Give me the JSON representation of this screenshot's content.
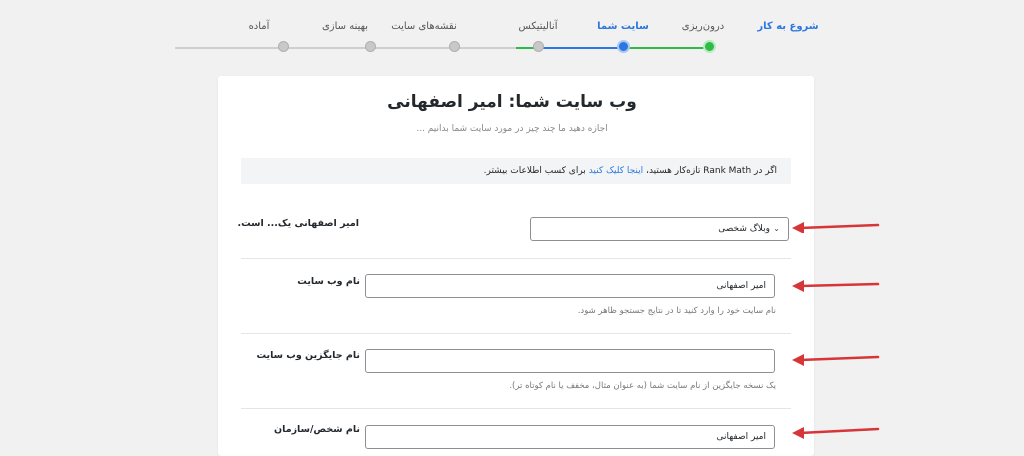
{
  "steps": [
    {
      "label": "شروع به کار",
      "state": "start"
    },
    {
      "label": "درون‌ریزی",
      "state": "done"
    },
    {
      "label": "سایت شما",
      "state": "active"
    },
    {
      "label": "آنالیتیکس",
      "state": "pending"
    },
    {
      "label": "نقشه‌های سایت",
      "state": "pending"
    },
    {
      "label": "بهینه سازی",
      "state": "pending"
    },
    {
      "label": "آماده",
      "state": "pending"
    }
  ],
  "colors": {
    "accent": "#2c76e0",
    "done": "#2fbb45",
    "arrow": "#d63638"
  },
  "header": {
    "title": "وب سایت شما: امیر اصفهانی",
    "subtitle": "اجازه دهید ما چند چیز در مورد سایت شما بدانیم ..."
  },
  "notice": {
    "prefix": "اگر در Rank Math تازه‌کار هستید،",
    "link": "اینجا کلیک کنید",
    "suffix": "برای کسب اطلاعات بیشتر."
  },
  "fields": {
    "site_type": {
      "label": "امیر اصفهانی یک... است.",
      "value": "وبلاگ شخصی"
    },
    "site_name": {
      "label": "نام وب سایت",
      "value": "امیر اصفهانی",
      "hint": "نام سایت خود را وارد کنید تا در نتایج جستجو ظاهر شود."
    },
    "alt_name": {
      "label": "نام جایگزین وب سایت",
      "value": "",
      "hint": "یک نسخه جایگزین از نام سایت شما (به عنوان مثال، مخفف یا نام کوتاه تر)."
    },
    "person_org": {
      "label": "نام شخص/سازمان",
      "value": "امیر اصفهانی"
    }
  }
}
